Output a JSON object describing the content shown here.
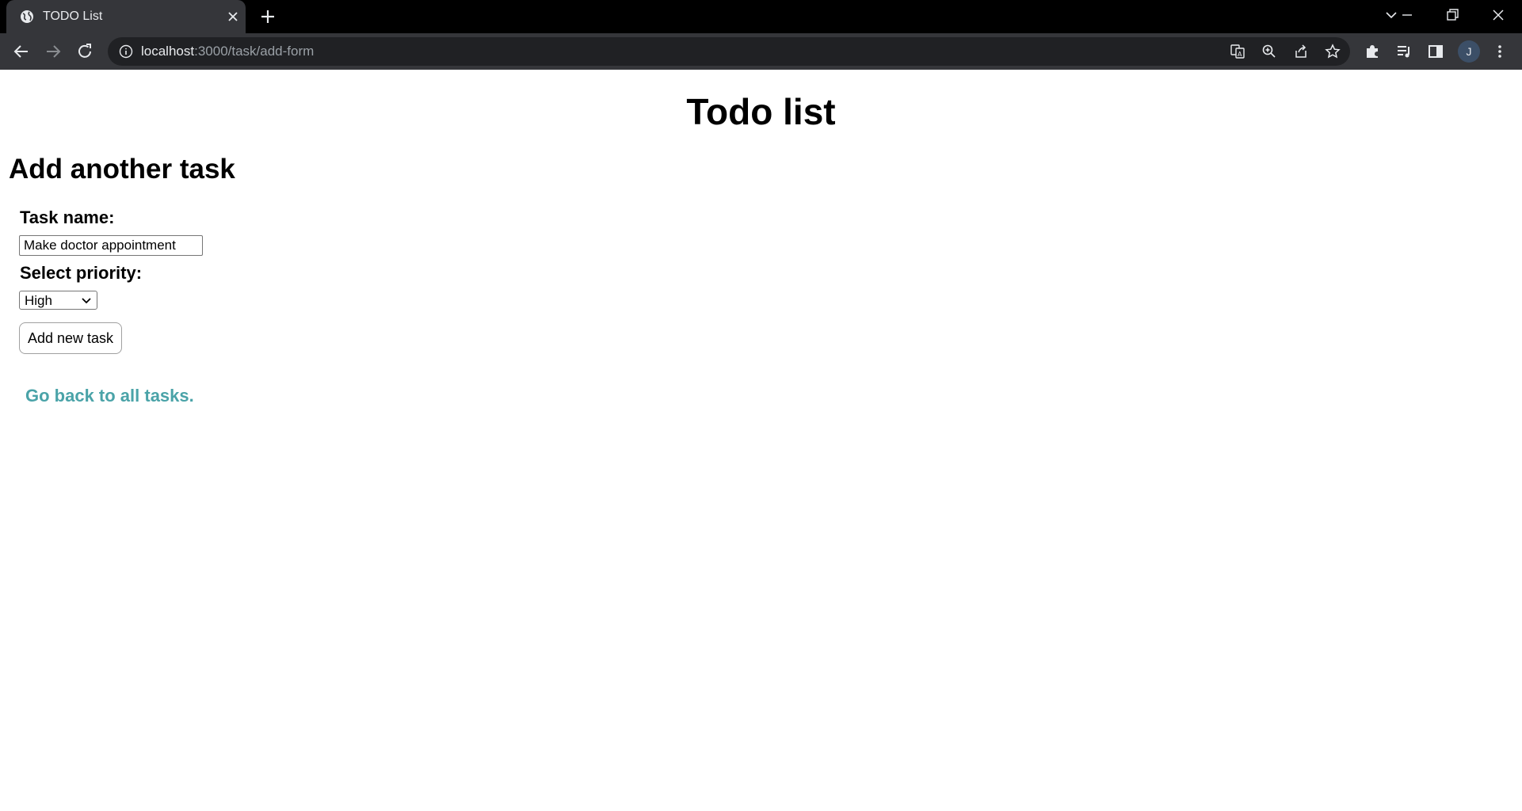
{
  "browser": {
    "tab_title": "TODO List",
    "url_host": "localhost",
    "url_path": ":3000/task/add-form",
    "profile_initial": "J",
    "icons": {
      "favicon": "globe-icon",
      "tab_close": "close-icon",
      "new_tab": "plus-icon",
      "tab_search": "chevron-down-icon",
      "minimize": "minimize-icon",
      "restore": "restore-icon",
      "close_window": "close-icon",
      "back": "arrow-left-icon",
      "forward": "arrow-right-icon",
      "reload": "reload-icon",
      "site_info": "info-icon",
      "translate": "translate-icon",
      "zoom": "zoom-icon",
      "share": "share-icon",
      "bookmark": "star-icon",
      "extensions": "puzzle-icon",
      "media": "media-queue-icon",
      "side_panel": "side-panel-icon",
      "menu": "kebab-menu-icon"
    }
  },
  "page": {
    "title": "Todo list",
    "section_title": "Add another task",
    "form": {
      "task_name_label": "Task name:",
      "task_name_value": "Make doctor appointment",
      "priority_label": "Select priority:",
      "priority_selected": "High",
      "submit_label": "Add new task"
    },
    "back_link": "Go back to all tasks.",
    "colors": {
      "link": "#4aa3a8",
      "chrome_bg": "#35363a",
      "tabstrip_bg": "#000000"
    }
  }
}
